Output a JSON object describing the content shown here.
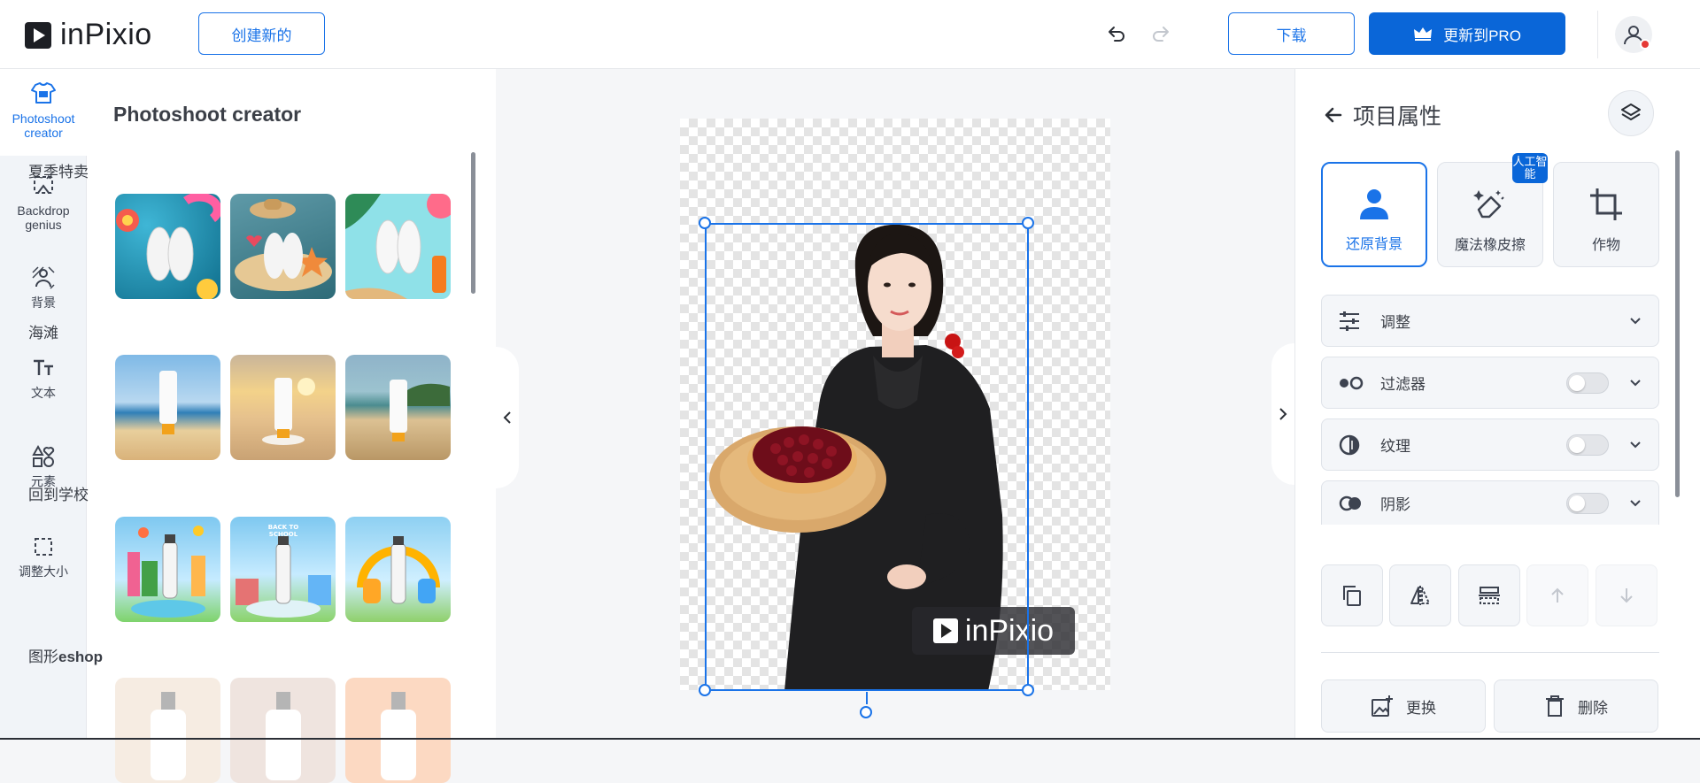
{
  "header": {
    "logo_text": "inPixio",
    "create_new_label": "创建新的",
    "download_label": "下载",
    "upgrade_label": "更新到PRO"
  },
  "rail": {
    "items": [
      {
        "label": "Photoshoot creator",
        "icon": "shirt-icon"
      },
      {
        "label": "Backdrop genius",
        "icon": "backdrop-icon"
      },
      {
        "label": "背景",
        "icon": "background-icon"
      },
      {
        "label": "文本",
        "icon": "text-icon"
      },
      {
        "label": "元素",
        "icon": "elements-icon"
      },
      {
        "label": "调整大小",
        "icon": "resize-icon"
      }
    ]
  },
  "panel": {
    "title": "Photoshoot creator",
    "sections": [
      {
        "label": "夏季特卖"
      },
      {
        "label": "海滩"
      },
      {
        "label": "回到学校"
      },
      {
        "label_prefix": "图形",
        "label_bold": "eshop"
      }
    ]
  },
  "canvas": {
    "watermark_text": "inPixio"
  },
  "properties": {
    "title": "项目属性",
    "tools": [
      {
        "label": "还原背景",
        "icon": "person-icon"
      },
      {
        "label": "魔法橡皮擦",
        "icon": "magic-eraser-icon"
      },
      {
        "label": "作物",
        "icon": "crop-icon"
      }
    ],
    "ai_badge": "人工智能",
    "accordions": [
      {
        "label": "调整",
        "icon": "sliders-icon"
      },
      {
        "label": "过滤器",
        "icon": "filter-icon"
      },
      {
        "label": "纹理",
        "icon": "texture-icon"
      },
      {
        "label": "阴影",
        "icon": "shadow-icon"
      }
    ],
    "replace_label": "更换",
    "delete_label": "删除"
  }
}
